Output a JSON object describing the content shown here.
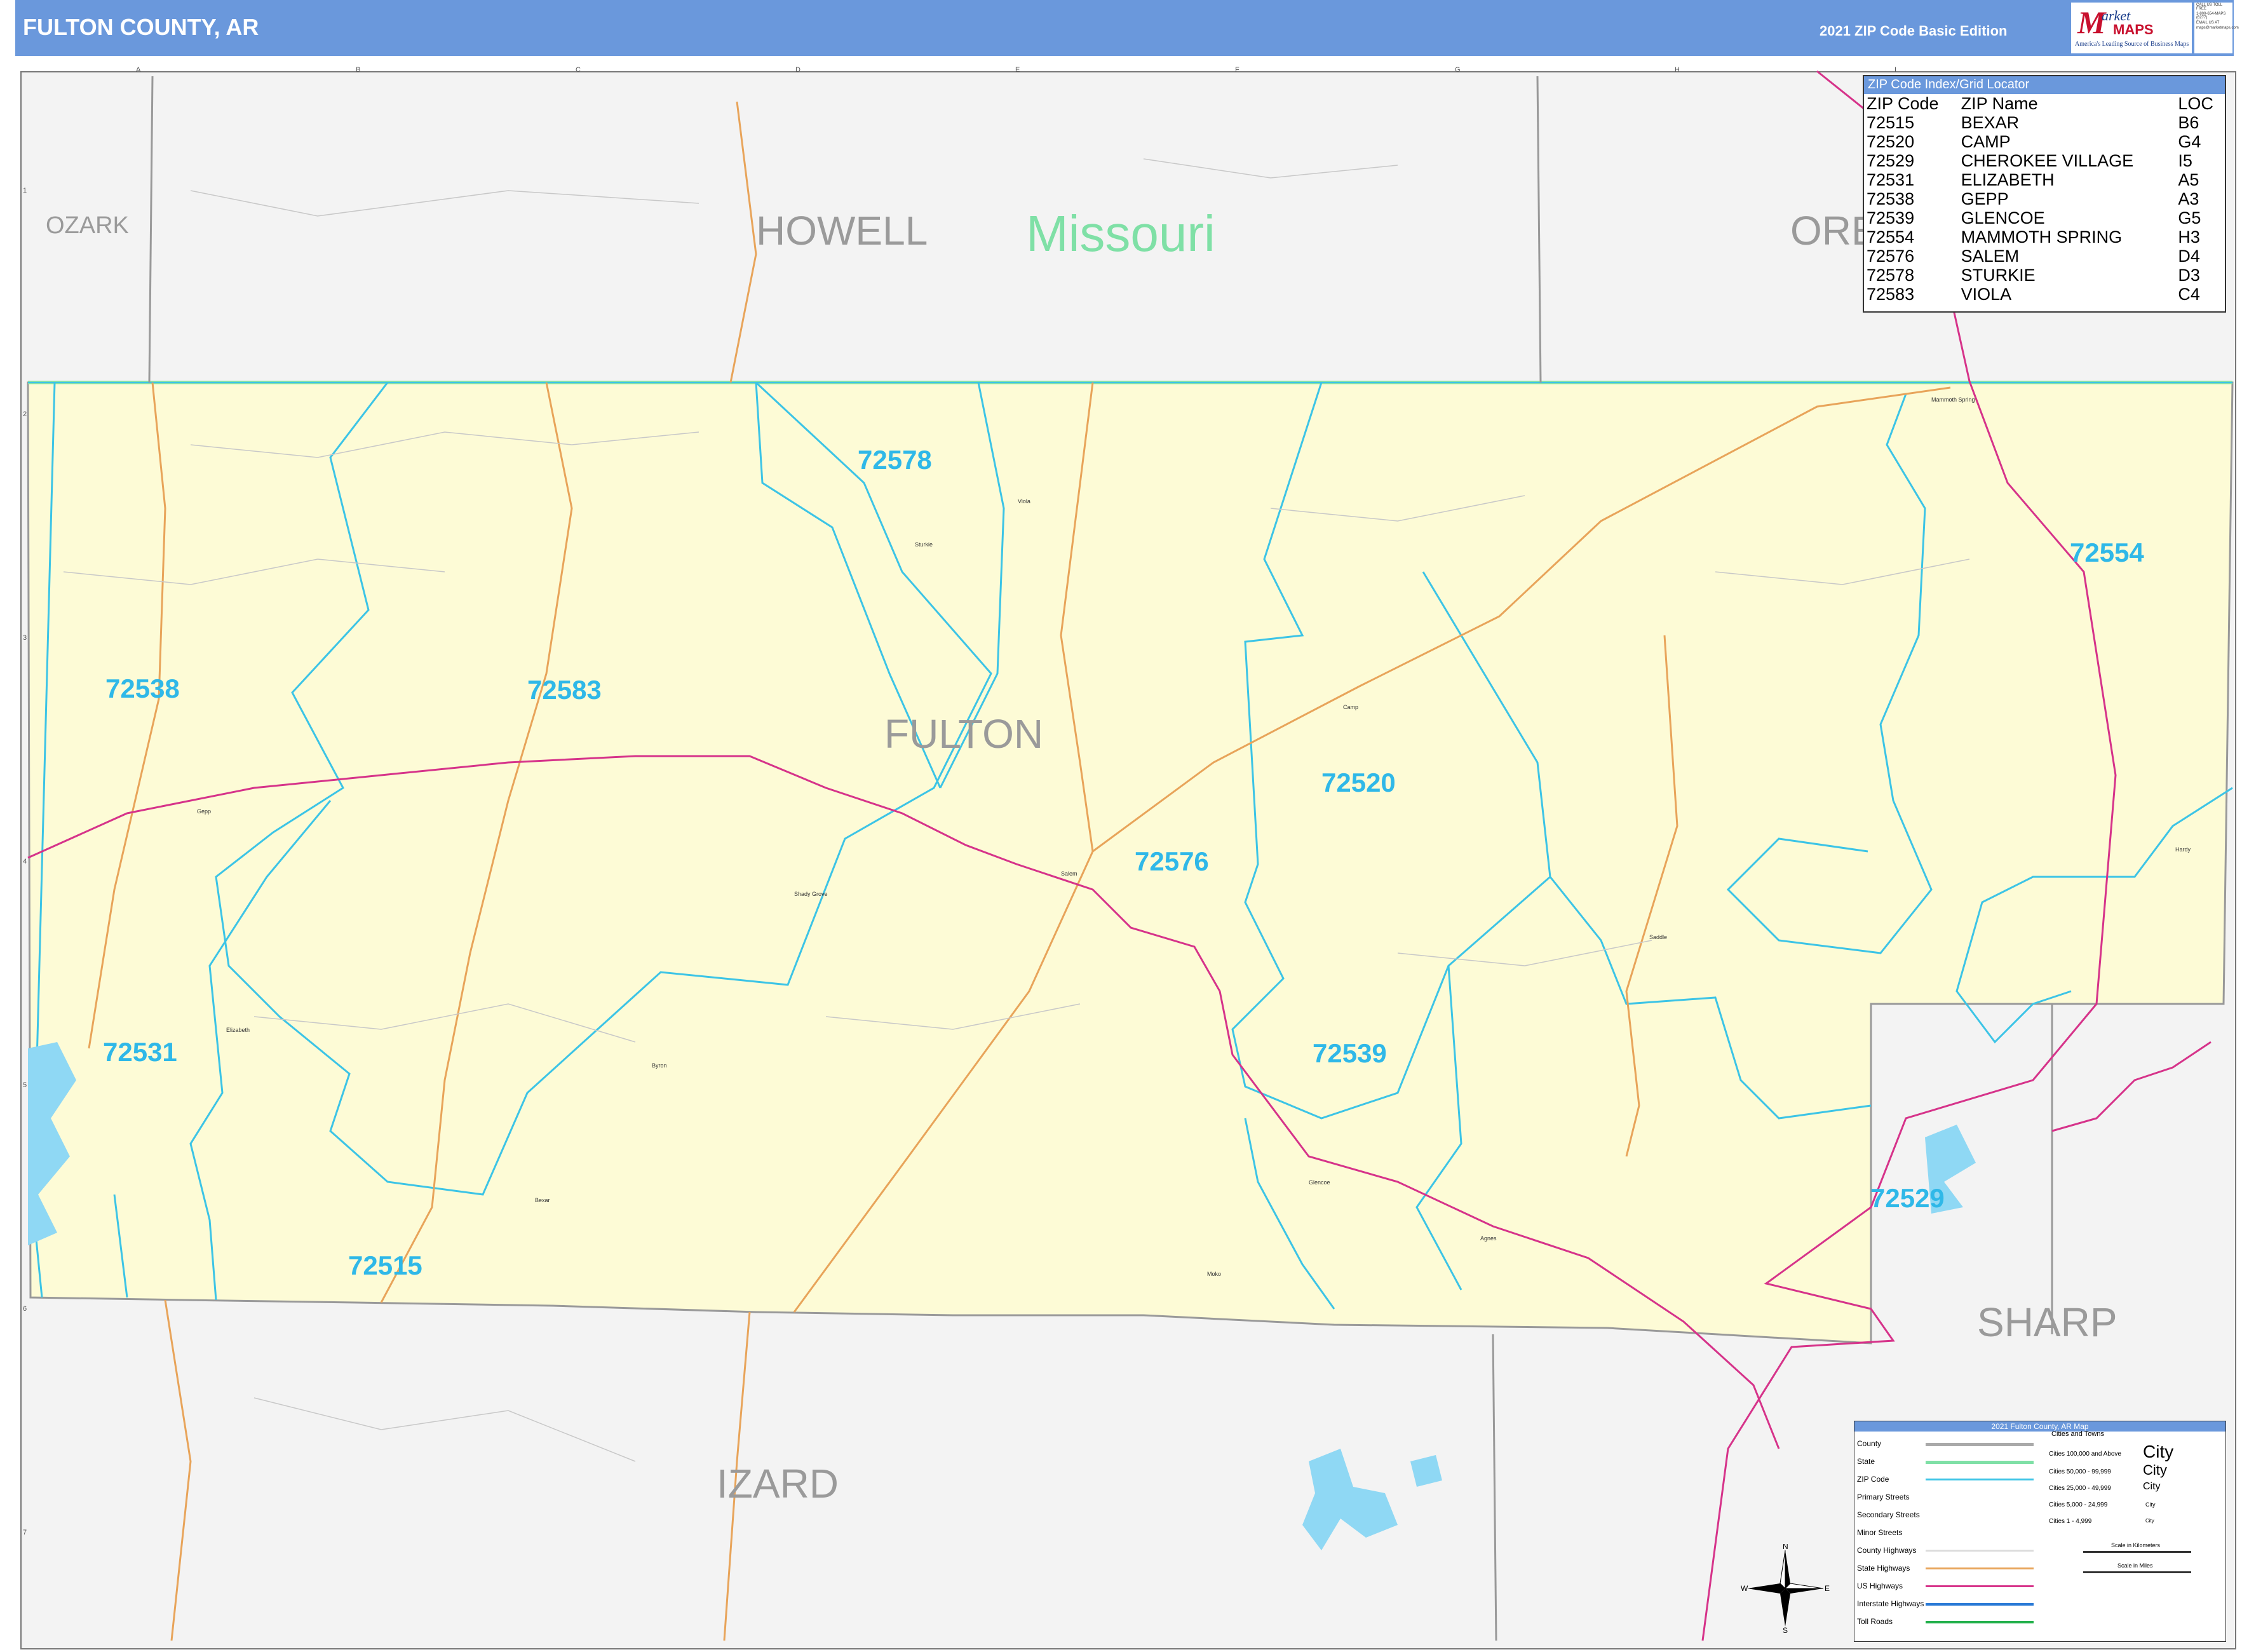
{
  "header": {
    "title": "FULTON COUNTY, AR",
    "edition": "2021 ZIP Code Basic Edition",
    "logo": {
      "m": "M",
      "arket": "arket",
      "maps": "MAPS",
      "tagline": "America's Leading Source of Business Maps"
    },
    "contact": [
      "CALL US TOLL FREE",
      "1-800-654-MAPS (6277)",
      "EMAIL US AT",
      "maps@marketmaps.com"
    ]
  },
  "map": {
    "state_label": "Missouri",
    "counties": [
      "OZARK",
      "HOWELL",
      "ORE",
      "FULTON",
      "IZARD",
      "SHARP"
    ],
    "zip_labels": [
      "72578",
      "72554",
      "72538",
      "72583",
      "72520",
      "72576",
      "72531",
      "72539",
      "72529",
      "72515"
    ],
    "towns": [
      "Viola",
      "Sturkie",
      "Salem",
      "Camp",
      "Glencoe",
      "Agnes",
      "Byron",
      "Bexar",
      "Elizabeth",
      "Gepp",
      "Mammoth Spring",
      "Shady Grove",
      "Hardy",
      "Saddle",
      "Moko"
    ],
    "grid_cols": [
      "A",
      "B",
      "C",
      "D",
      "E",
      "F",
      "G",
      "H",
      "I"
    ],
    "grid_rows": [
      "1",
      "2",
      "3",
      "4",
      "5",
      "6",
      "7"
    ],
    "colors": {
      "county_fill": "#fdfbd6",
      "zip_boundary": "#3cc4e6",
      "us_highway": "#d6338a",
      "state_highway": "#e8a45a",
      "water": "#8fd8f4"
    }
  },
  "index": {
    "title": "ZIP Code Index/Grid Locator",
    "columns": [
      "ZIP Code",
      "ZIP Name",
      "LOC"
    ],
    "rows": [
      [
        "72515",
        "BEXAR",
        "B6"
      ],
      [
        "72520",
        "CAMP",
        "G4"
      ],
      [
        "72529",
        "CHEROKEE VILLAGE",
        "I5"
      ],
      [
        "72531",
        "ELIZABETH",
        "A5"
      ],
      [
        "72538",
        "GEPP",
        "A3"
      ],
      [
        "72539",
        "GLENCOE",
        "G5"
      ],
      [
        "72554",
        "MAMMOTH SPRING",
        "H3"
      ],
      [
        "72576",
        "SALEM",
        "D4"
      ],
      [
        "72578",
        "STURKIE",
        "D3"
      ],
      [
        "72583",
        "VIOLA",
        "C4"
      ]
    ]
  },
  "legend": {
    "title": "2021 Fulton County, AR Map",
    "items": [
      "County",
      "State",
      "ZIP Code",
      "Primary Streets",
      "Secondary Streets",
      "Minor Streets",
      "County Highways",
      "State Highways",
      "US Highways",
      "Interstate Highways",
      "Toll Roads"
    ],
    "cities_title": "Cities and Towns",
    "cities": [
      "Cities 100,000 and Above",
      "Cities 50,000 - 99,999",
      "Cities 25,000 - 49,999",
      "Cities 5,000 - 24,999",
      "Cities 1 - 4,999"
    ],
    "city_samples": [
      "City",
      "City",
      "City",
      "City",
      "City"
    ],
    "scale_km": "Scale in Kilometers",
    "scale_mi": "Scale in Miles",
    "compass": [
      "N",
      "S",
      "E",
      "W"
    ]
  }
}
